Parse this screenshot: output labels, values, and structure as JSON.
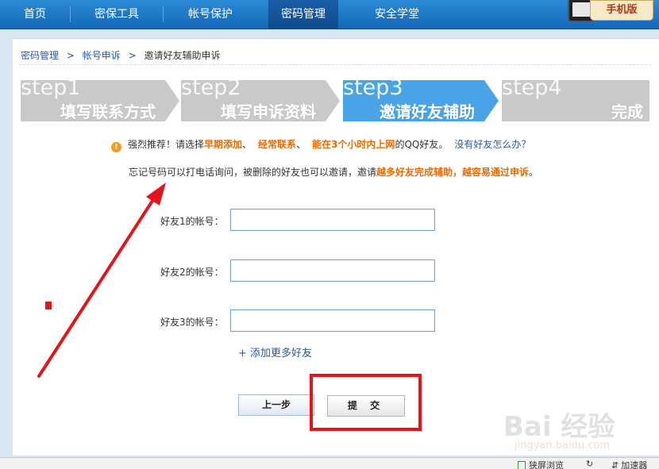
{
  "nav": {
    "items": [
      {
        "label": "首页"
      },
      {
        "label": "密保工具"
      },
      {
        "label": "帐号保护"
      },
      {
        "label": "密码管理"
      },
      {
        "label": "安全学堂"
      }
    ],
    "active_index": 3,
    "mobile_badge": "手机版"
  },
  "breadcrumb": {
    "items": [
      "密码管理",
      "帐号申诉"
    ],
    "separator": ">",
    "current": "邀请好友辅助申诉"
  },
  "steps": [
    {
      "big": "step1",
      "label": "填写联系方式",
      "active": false
    },
    {
      "big": "step2",
      "label": "填写申诉资料",
      "active": false
    },
    {
      "big": "step3",
      "label": "邀请好友辅助",
      "active": true
    },
    {
      "big": "step4",
      "label": "完成",
      "active": false
    }
  ],
  "tip1": {
    "prefix": "强烈推荐！请选择",
    "opt1": "早期添加",
    "sep1": "、",
    "opt2": "经常联系",
    "sep2": "、",
    "opt3": "能在3个小时内上网",
    "suffix": "的QQ好友。",
    "link": "没有好友怎么办？"
  },
  "tip2": {
    "prefix": "忘记号码可以打电话询问，被删除的好友也可以邀请，邀请",
    "highlight": "越多好友完成辅助，越容易通过申诉",
    "suffix": "。"
  },
  "fields": [
    {
      "label": "好友1的帐号：",
      "value": ""
    },
    {
      "label": "好友2的帐号：",
      "value": ""
    },
    {
      "label": "好友3的帐号：",
      "value": ""
    }
  ],
  "add_more": "+ 添加更多好友",
  "buttons": {
    "prev": "上一步",
    "submit": "提 交"
  },
  "status_bar": {
    "item1": "狭屏浏览",
    "item2": "加速器"
  },
  "watermark": {
    "main": "Bai 经验",
    "sub": "jingyan.baidu.com"
  },
  "colors": {
    "active_step": "#4aa3e6",
    "inactive_step": "#c9c9c9",
    "highlight": "#ea6a00",
    "annotation": "#e2151b"
  }
}
